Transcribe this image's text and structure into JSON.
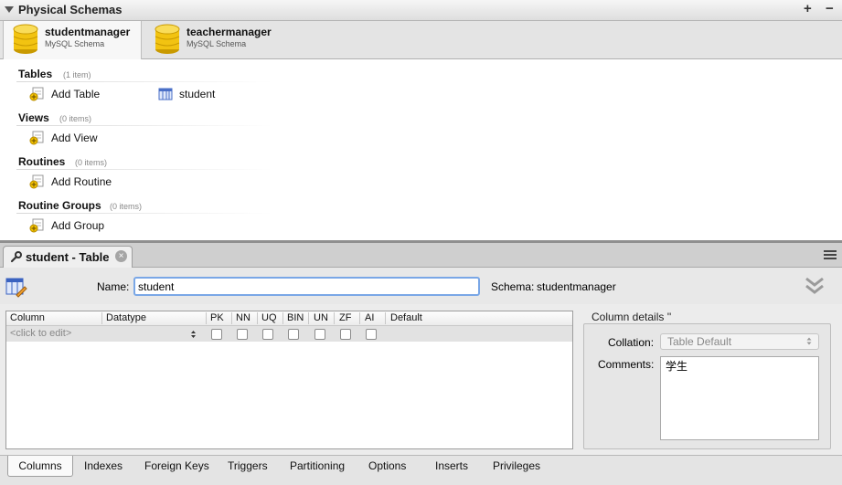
{
  "panel": {
    "title": "Physical Schemas",
    "add_label": "+",
    "remove_label": "−"
  },
  "schemas": [
    {
      "name": "studentmanager",
      "type": "MySQL Schema"
    },
    {
      "name": "teachermanager",
      "type": "MySQL Schema"
    }
  ],
  "sections": [
    {
      "title": "Tables",
      "count": "(1 item)",
      "add_label": "Add Table",
      "items": [
        "student"
      ]
    },
    {
      "title": "Views",
      "count": "(0 items)",
      "add_label": "Add View",
      "items": []
    },
    {
      "title": "Routines",
      "count": "(0 items)",
      "add_label": "Add Routine",
      "items": []
    },
    {
      "title": "Routine Groups",
      "count": "(0 items)",
      "add_label": "Add Group",
      "items": []
    }
  ],
  "editor_tab": {
    "label": "student - Table",
    "close": "×"
  },
  "table_editor": {
    "name_label": "Name:",
    "name_value": "student",
    "schema_label": "Schema:",
    "schema_value": "studentmanager"
  },
  "grid": {
    "headers": [
      "Column",
      "Datatype",
      "PK",
      "NN",
      "UQ",
      "BIN",
      "UN",
      "ZF",
      "AI",
      "Default"
    ],
    "placeholder_row": "<click to edit>"
  },
  "column_details": {
    "title": "Column details ''",
    "collation_label": "Collation:",
    "collation_value": "Table Default",
    "comments_label": "Comments:",
    "comments_value": "学生"
  },
  "bottom_tabs": [
    "Columns",
    "Indexes",
    "Foreign Keys",
    "Triggers",
    "Partitioning",
    "Options",
    "Inserts",
    "Privileges"
  ],
  "colors": {
    "focus_ring": "#7aa7e6",
    "db_icon": "#f2c311",
    "divider": "#8f8f8f"
  }
}
